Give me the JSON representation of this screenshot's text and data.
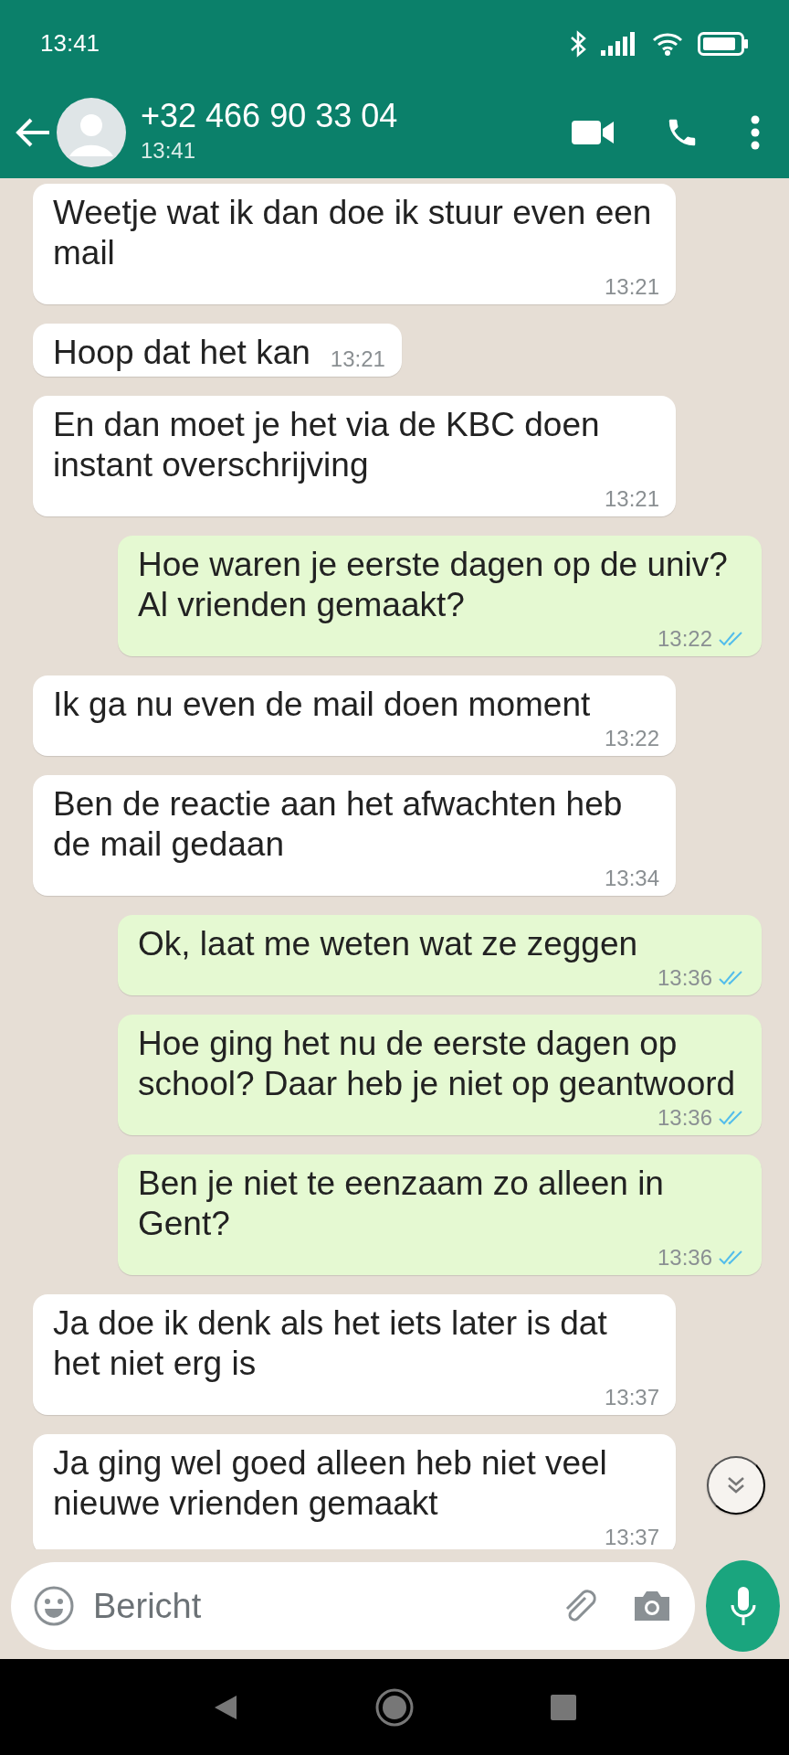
{
  "status_bar": {
    "time": "13:41"
  },
  "header": {
    "title": "+32 466 90 33 04",
    "subtitle": "13:41"
  },
  "messages": [
    {
      "kind": "incoming",
      "text": "Weetje wat ik dan doe ik stuur even een mail",
      "time": "13:21"
    },
    {
      "kind": "incoming",
      "text": "Hoop dat het kan",
      "time": "13:21"
    },
    {
      "kind": "incoming",
      "text": "En dan moet je het via de KBC doen instant overschrijving",
      "time": "13:21"
    },
    {
      "kind": "outgoing",
      "text": "Hoe waren je eerste dagen op de univ? Al vrienden gemaakt?",
      "time": "13:22",
      "read": true
    },
    {
      "kind": "incoming",
      "text": "Ik ga nu even de mail doen moment",
      "time": "13:22"
    },
    {
      "kind": "incoming",
      "text": "Ben de reactie aan het afwachten heb de mail gedaan",
      "time": "13:34"
    },
    {
      "kind": "outgoing",
      "text": "Ok, laat me weten wat ze zeggen",
      "time": "13:36",
      "read": true
    },
    {
      "kind": "outgoing",
      "text": "Hoe ging het nu de eerste dagen op school? Daar heb je niet op geantwoord",
      "time": "13:36",
      "read": true
    },
    {
      "kind": "outgoing",
      "text": "Ben je niet te eenzaam zo alleen in Gent?",
      "time": "13:36",
      "read": true
    },
    {
      "kind": "incoming",
      "text": "Ja doe ik denk als het iets later is dat het niet erg is",
      "time": "13:37"
    },
    {
      "kind": "incoming",
      "text": "Ja ging wel goed alleen heb niet veel nieuwe vrienden gemaakt",
      "time": "13:37"
    }
  ],
  "composer": {
    "placeholder": "Bericht"
  }
}
